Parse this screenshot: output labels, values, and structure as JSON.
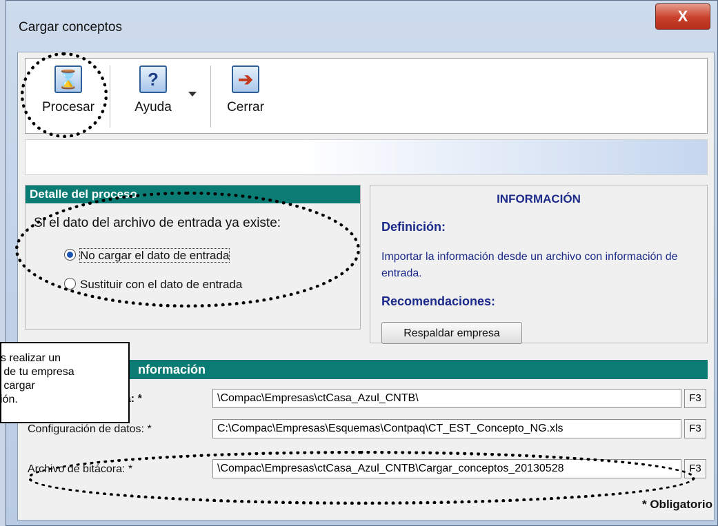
{
  "window": {
    "title": "Cargar conceptos",
    "close_label": "X"
  },
  "toolbar": {
    "procesar": "Procesar",
    "ayuda": "Ayuda",
    "cerrar": "Cerrar",
    "procesar_icon": "hourglass-icon",
    "ayuda_icon": "help-icon",
    "cerrar_icon": "exit-door-icon"
  },
  "detalle": {
    "header": "Detalle del proceso",
    "question": "Si el dato del archivo de entrada ya existe:",
    "options": [
      {
        "label": "No cargar el dato de entrada",
        "selected": true
      },
      {
        "label": "Sustituir con el dato de entrada",
        "selected": false
      }
    ]
  },
  "info": {
    "header": "INFORMACIÓN",
    "def_label": "Definición:",
    "def_text": "Importar la información desde un archivo con información de entrada.",
    "rec_label": "Recomendaciones:",
    "button": "Respaldar empresa"
  },
  "files": {
    "header": "nformación",
    "rows": [
      {
        "label": "rada: *",
        "value": "\\Compac\\Empresas\\ctCasa_Azul_CNTB\\",
        "key": "F3"
      },
      {
        "label": "Configuración de datos: *",
        "value": "C:\\Compac\\Empresas\\Esquemas\\Contpaq\\CT_EST_Concepto_NG.xls",
        "key": "F3"
      },
      {
        "label": "Archivo de bitácora: *",
        "value": "\\Compac\\Empresas\\ctCasa_Azul_CNTB\\Cargar_conceptos_20130528",
        "key": "F3"
      }
    ],
    "required": "* Obligatorio"
  },
  "callout": {
    "lines": [
      "es realizar un",
      "o de tu empresa",
      "e cargar",
      "ción."
    ]
  }
}
